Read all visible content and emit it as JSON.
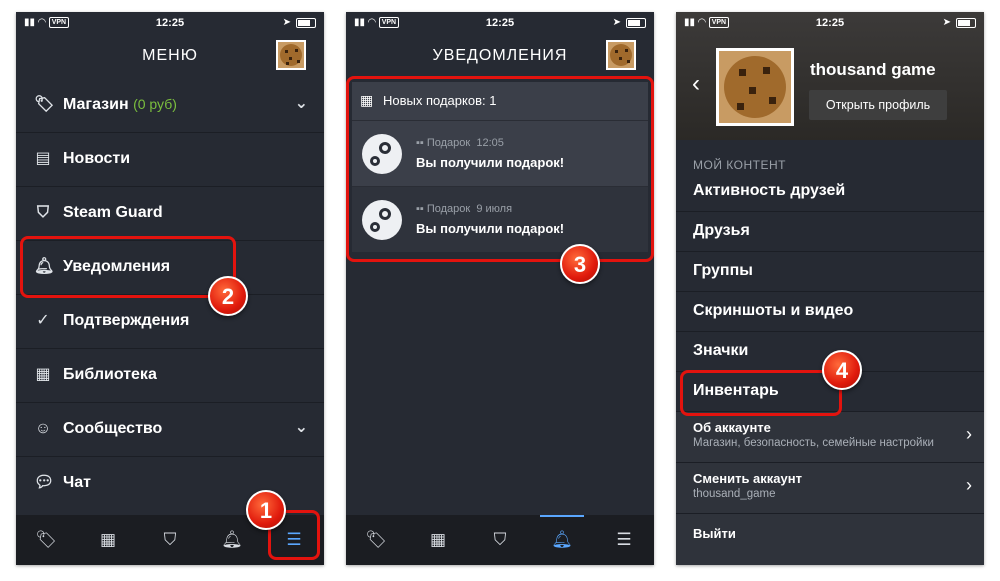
{
  "status": {
    "time": "12:25",
    "vpn": "VPN"
  },
  "panel1": {
    "title": "МЕНЮ",
    "menu": [
      {
        "label": "Магазин",
        "extra": "(0 руб)",
        "icon": "tag-icon"
      },
      {
        "label": "Новости",
        "icon": "news-icon"
      },
      {
        "label": "Steam Guard",
        "icon": "shield-icon"
      },
      {
        "label": "Уведомления",
        "icon": "bell-icon"
      },
      {
        "label": "Подтверждения",
        "icon": "check-icon"
      },
      {
        "label": "Библиотека",
        "icon": "grid-icon"
      },
      {
        "label": "Сообщество",
        "icon": "community-icon"
      },
      {
        "label": "Чат",
        "icon": "chat-icon"
      }
    ],
    "badges": [
      "1",
      "2"
    ]
  },
  "panel2": {
    "title": "УВЕДОМЛЕНИЯ",
    "header": "Новых подарков: 1",
    "notifications": [
      {
        "type": "Подарок",
        "time": "12:05",
        "text": "Вы получили подарок!"
      },
      {
        "type": "Подарок",
        "time": "9 июля",
        "text": "Вы получили подарок!"
      }
    ],
    "badge": "3"
  },
  "panel3": {
    "username": "thousand game",
    "open_profile": "Открыть профиль",
    "section": "МОЙ КОНТЕНТ",
    "items": [
      "Активность друзей",
      "Друзья",
      "Группы",
      "Скриншоты и видео",
      "Значки",
      "Инвентарь"
    ],
    "account": {
      "title": "Об аккаунте",
      "subtitle": "Магазин, безопасность, семейные настройки"
    },
    "switch": {
      "title": "Сменить аккаунт",
      "subtitle": "thousand_game"
    },
    "logout": "Выйти",
    "badge": "4"
  }
}
